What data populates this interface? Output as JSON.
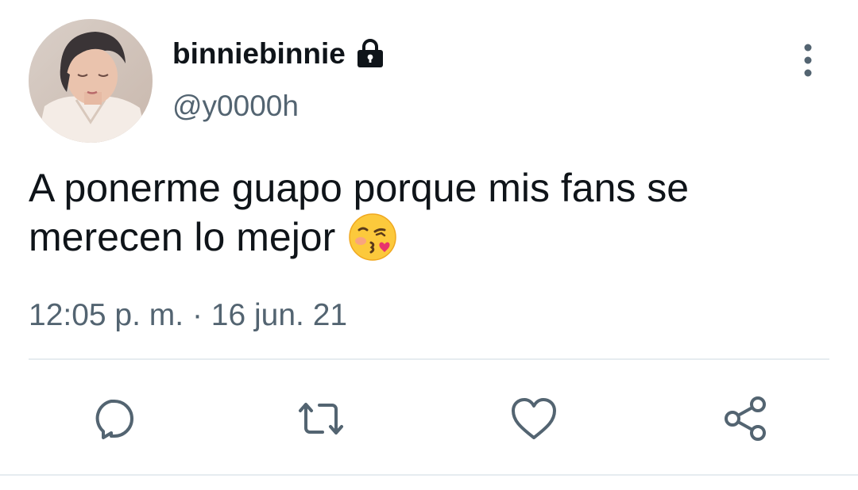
{
  "tweet": {
    "display_name": "binniebinnie",
    "handle": "@y0000h",
    "text_line1": "A ponerme guapo porque mis fans se",
    "text_line2": "merecen lo mejor",
    "timestamp": "12:05 p. m. · 16 jun. 21"
  },
  "icons": {
    "lock": "lock-icon",
    "more": "more-vertical-icon",
    "emoji": "face-blowing-kiss-emoji",
    "reply": "reply-icon",
    "retweet": "retweet-icon",
    "like": "heart-icon",
    "share": "share-icon"
  },
  "colors": {
    "text": "#0f1419",
    "secondary": "#536471",
    "divider": "#e6ecf0"
  }
}
